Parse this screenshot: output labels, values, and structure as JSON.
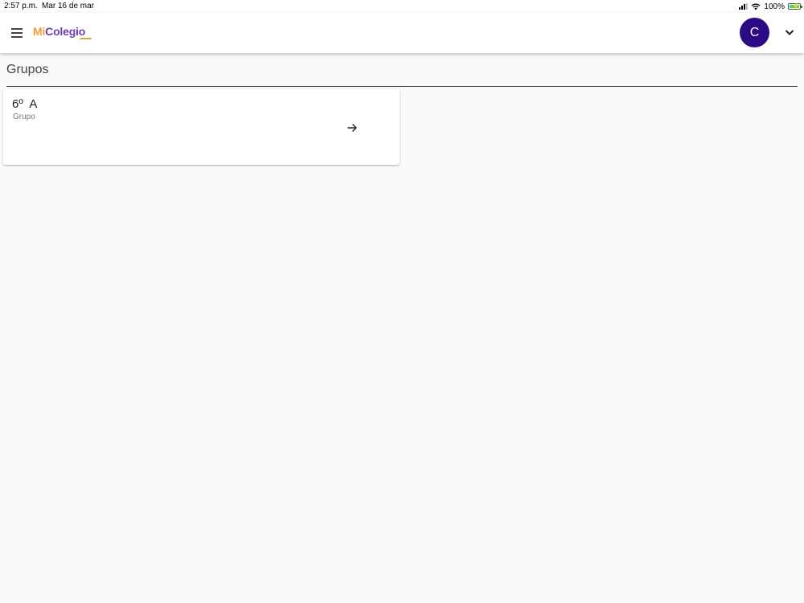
{
  "status_bar": {
    "time": "2:57 p.m.",
    "date": "Mar 16 de mar",
    "battery": "100%",
    "icons": [
      "cellular-signal-icon",
      "wifi-icon",
      "battery-charging-icon"
    ]
  },
  "header": {
    "menu_icon": "hamburger-menu-icon",
    "logo": {
      "part1": "Mi",
      "part2": "Colegio"
    },
    "avatar_initial": "C",
    "dropdown_icon": "chevron-down-icon"
  },
  "page": {
    "title": "Grupos"
  },
  "groups": [
    {
      "name": "6º  A",
      "subtitle": "Grupo",
      "icon": "arrow-right-icon"
    }
  ],
  "colors": {
    "brand_orange": "#f29c38",
    "brand_purple": "#6a3fb5",
    "avatar_bg": "#2d0a85",
    "background": "#fafafa"
  }
}
